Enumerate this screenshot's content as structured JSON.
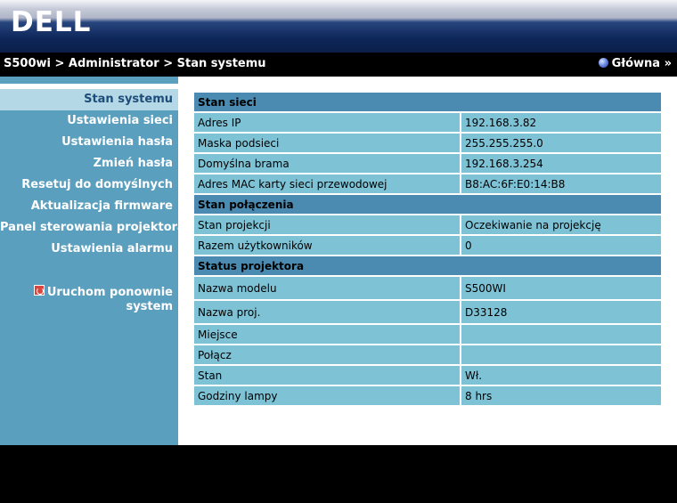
{
  "brand": {
    "logo_text": "DELL"
  },
  "navbar": {
    "breadcrumb": "S500wi > Administrator > Stan systemu",
    "home_label": "Główna »"
  },
  "sidebar": {
    "items": [
      {
        "label": "Stan systemu",
        "active": true
      },
      {
        "label": "Ustawienia sieci"
      },
      {
        "label": "Ustawienia hasła"
      },
      {
        "label": "Zmień hasła"
      },
      {
        "label": "Resetuj do domyślnych"
      },
      {
        "label": "Aktualizacja firmware"
      },
      {
        "label": "Panel sterowania projektora"
      },
      {
        "label": "Ustawienia alarmu"
      }
    ],
    "reboot": {
      "line1": "Uruchom ponownie",
      "line2": "system",
      "icon": "power-icon"
    }
  },
  "status": {
    "sections": [
      {
        "title": "Stan sieci",
        "rows": [
          {
            "label": "Adres IP",
            "value": "192.168.3.82"
          },
          {
            "label": "Maska podsieci",
            "value": "255.255.255.0"
          },
          {
            "label": "Domyślna brama",
            "value": "192.168.3.254"
          },
          {
            "label": "Adres MAC karty sieci przewodowej",
            "value": "B8:AC:6F:E0:14:B8"
          }
        ]
      },
      {
        "title": "Stan połączenia",
        "rows": [
          {
            "label": "Stan projekcji",
            "value": "Oczekiwanie na projekcję"
          },
          {
            "label": "Razem użytkowników",
            "value": "0"
          }
        ]
      },
      {
        "title": "Status projektora",
        "rows": [
          {
            "label": "Nazwa modelu",
            "value": "S500WI"
          },
          {
            "label": "Nazwa proj.",
            "value": "D33128"
          },
          {
            "label": "Miejsce",
            "value": ""
          },
          {
            "label": "Połącz",
            "value": ""
          },
          {
            "label": "Stan",
            "value": "Wł."
          },
          {
            "label": "Godziny lampy",
            "value": "8 hrs"
          }
        ]
      }
    ]
  },
  "colors": {
    "sidebar_bg": "#5b9fbf",
    "sidebar_active_bg": "#b5d8e7",
    "section_header_bg": "#4b8bb2",
    "row_bg": "#7ec2d6",
    "header_dark": "#0d2658"
  }
}
